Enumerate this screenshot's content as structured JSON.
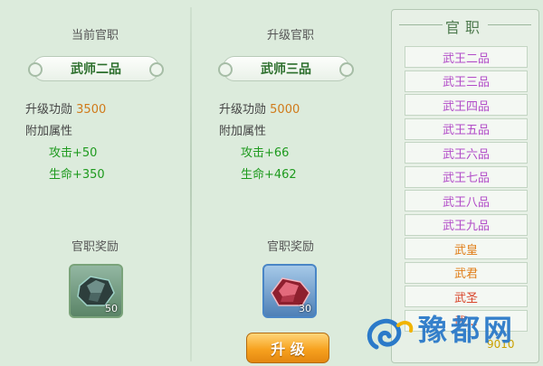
{
  "left": {
    "title": "当前官职",
    "rank": "武师二品",
    "exp_label": "升级功勋",
    "exp_value": "3500",
    "attr_label": "附加属性",
    "attack": "攻击+50",
    "life": "生命+350",
    "reward_title": "官职奖励",
    "reward_count": "50"
  },
  "middle": {
    "title": "升级官职",
    "rank": "武师三品",
    "exp_label": "升级功勋",
    "exp_value": "5000",
    "attr_label": "附加属性",
    "attack": "攻击+66",
    "life": "生命+462",
    "reward_title": "官职奖励",
    "reward_count": "30",
    "upgrade_label": "升 级"
  },
  "right": {
    "title": "官职",
    "ranks": [
      {
        "label": "武王二品",
        "color": "purple"
      },
      {
        "label": "武王三品",
        "color": "purple"
      },
      {
        "label": "武王四品",
        "color": "purple"
      },
      {
        "label": "武王五品",
        "color": "purple"
      },
      {
        "label": "武王六品",
        "color": "purple"
      },
      {
        "label": "武王七品",
        "color": "purple"
      },
      {
        "label": "武王八品",
        "color": "purple"
      },
      {
        "label": "武王九品",
        "color": "purple"
      },
      {
        "label": "武皇",
        "color": "orange"
      },
      {
        "label": "武君",
        "color": "orange"
      },
      {
        "label": "武圣",
        "color": "red"
      },
      {
        "label": "武…",
        "color": "red"
      }
    ],
    "footer_value": "9010"
  },
  "watermark": {
    "text": "豫都网"
  }
}
